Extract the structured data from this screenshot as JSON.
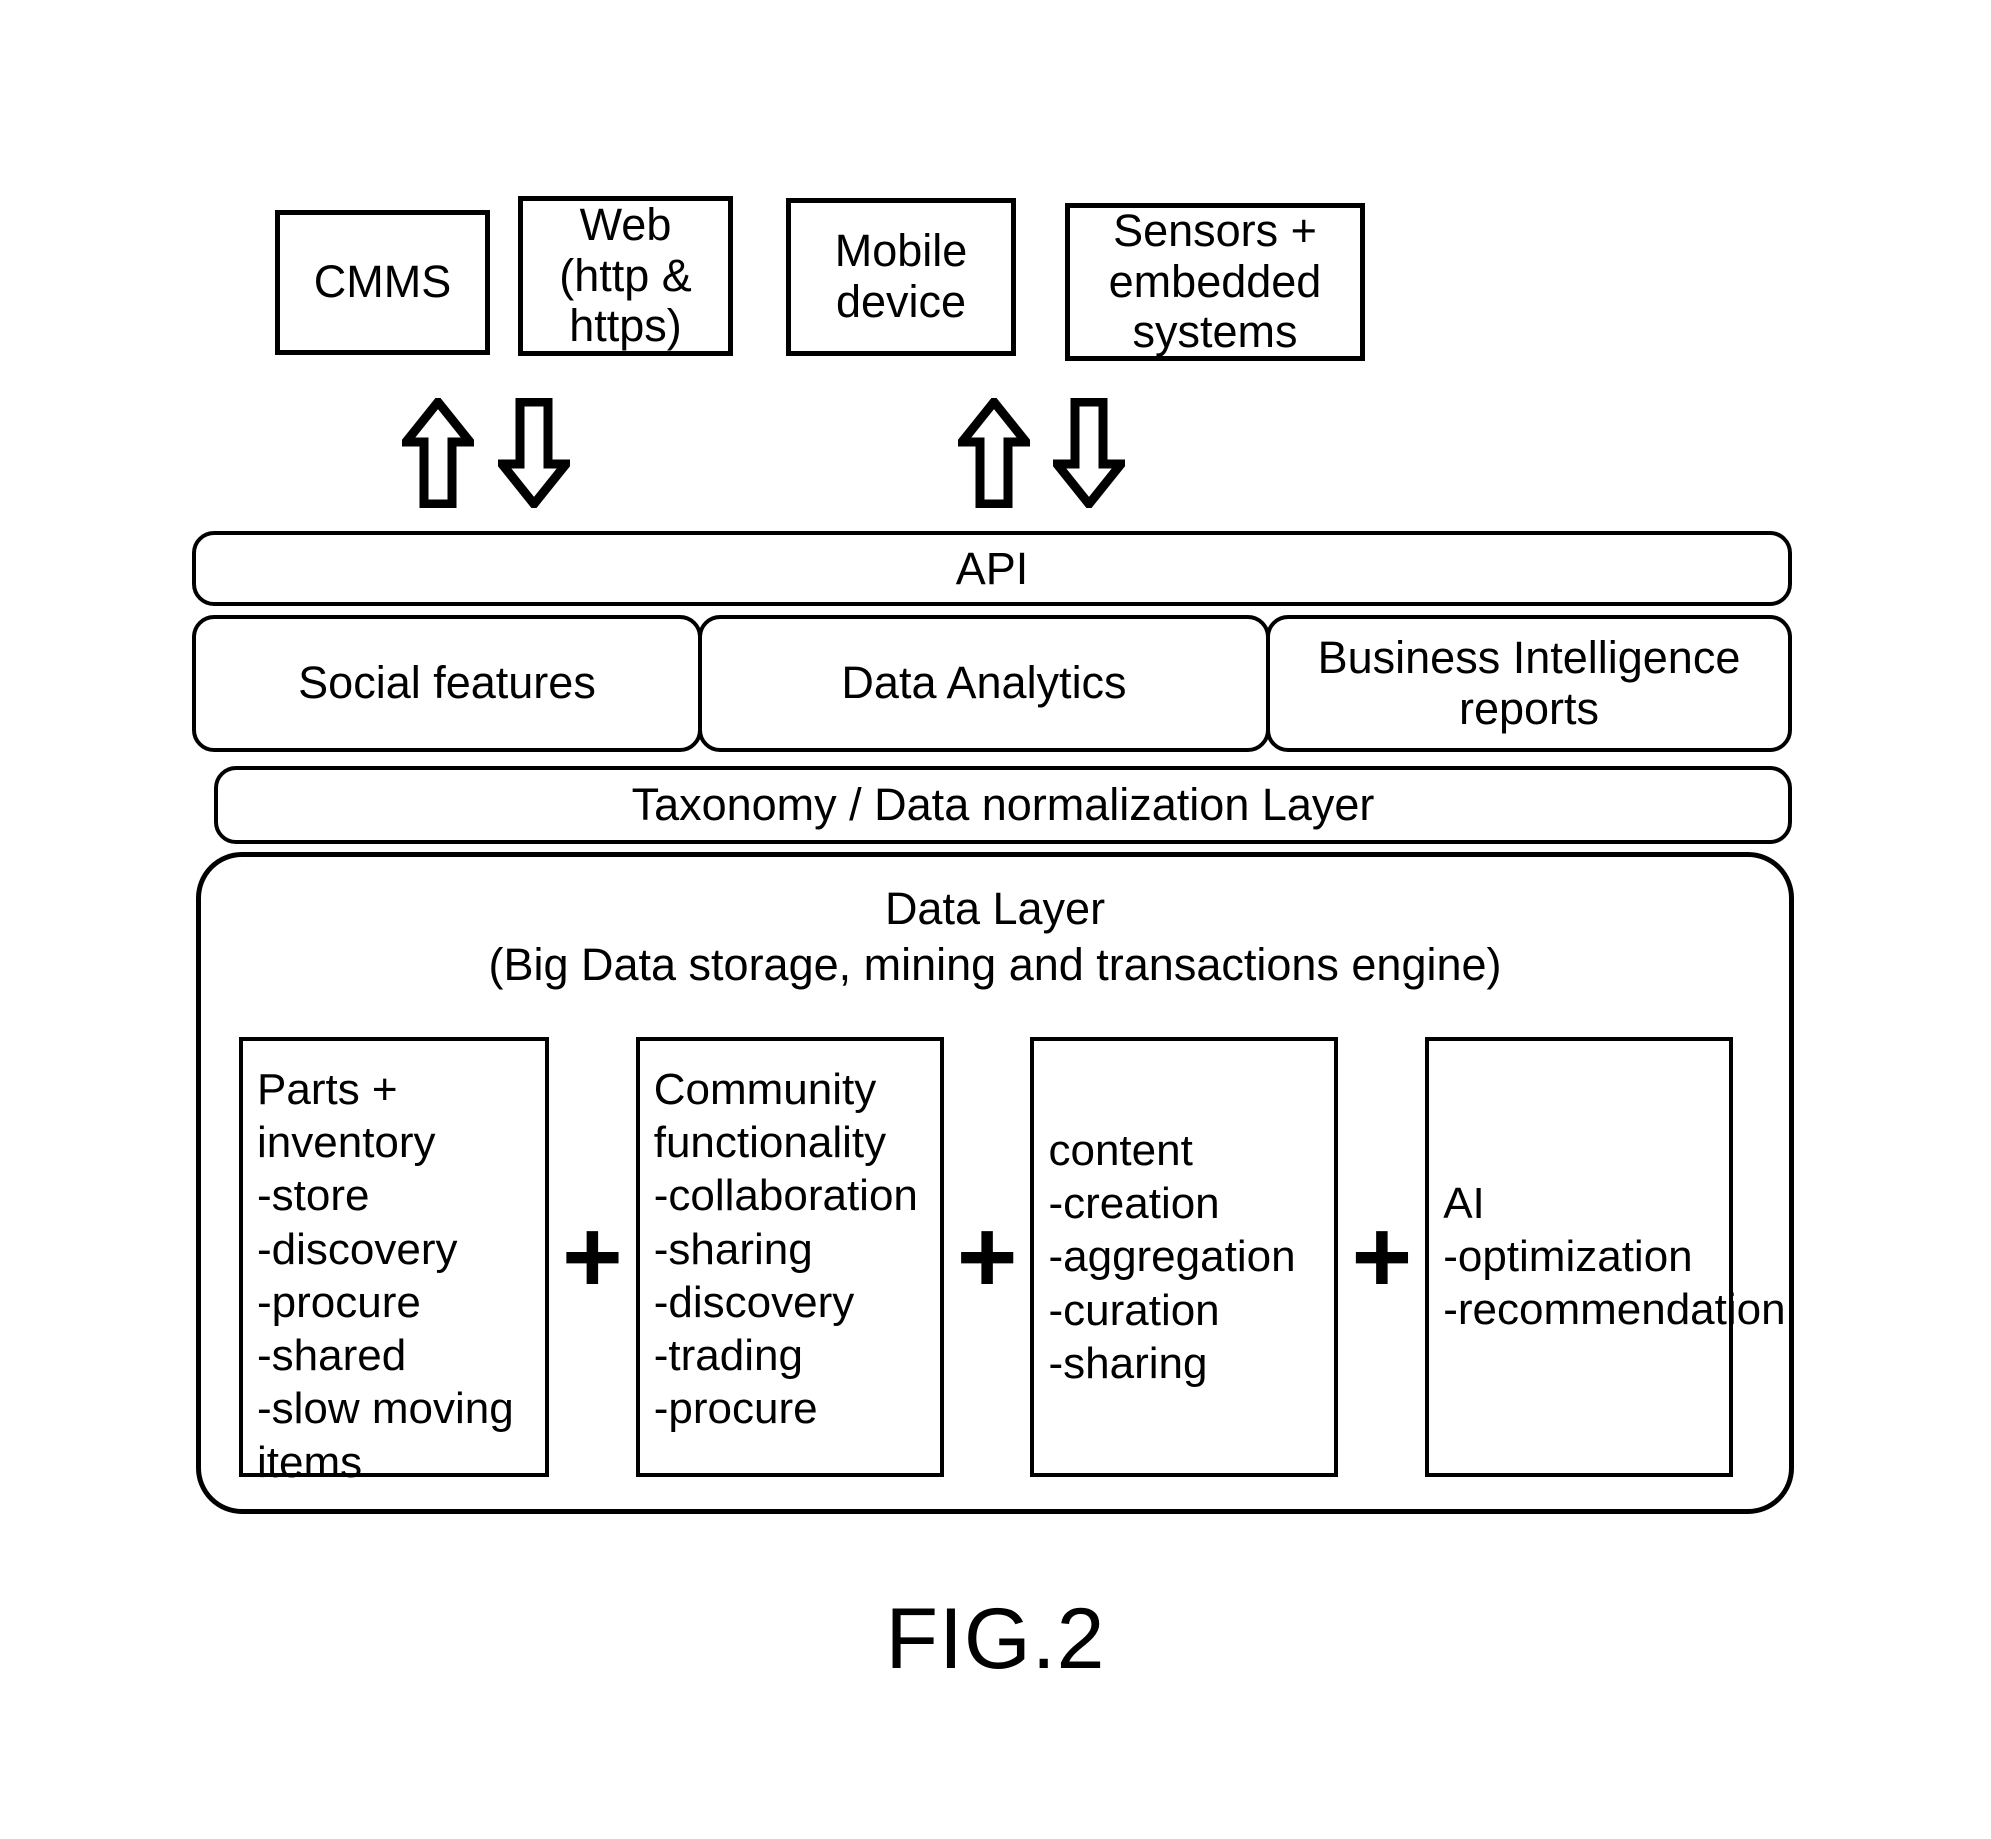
{
  "figure": {
    "caption": "FIG.2"
  },
  "endpoints": [
    {
      "id": "cmms",
      "label": "CMMS"
    },
    {
      "id": "web",
      "label": "Web\n(http &\nhttps)"
    },
    {
      "id": "mobile",
      "label": "Mobile\ndevice"
    },
    {
      "id": "sensor",
      "label": "Sensors +\nembedded\nsystems"
    }
  ],
  "arrows": [
    {
      "id": "cmms-up",
      "direction": "up",
      "icon": "arrow-up-icon"
    },
    {
      "id": "cmms-down",
      "direction": "down",
      "icon": "arrow-down-icon"
    },
    {
      "id": "mobile-up",
      "direction": "up",
      "icon": "arrow-up-icon"
    },
    {
      "id": "mobile-down",
      "direction": "down",
      "icon": "arrow-down-icon"
    }
  ],
  "api": {
    "label": "API"
  },
  "services": [
    {
      "id": "social",
      "label": "Social features"
    },
    {
      "id": "analytics",
      "label": "Data Analytics"
    },
    {
      "id": "bi",
      "label": "Business Intelligence\nreports"
    }
  ],
  "taxonomy": {
    "label": "Taxonomy / Data normalization Layer"
  },
  "data_layer": {
    "title_line1": "Data Layer",
    "title_line2": "(Big Data storage, mining and transactions engine)",
    "plus_symbol": "+",
    "components": [
      {
        "id": "parts",
        "align": "top",
        "lines": [
          "Parts +",
          "inventory",
          "-store",
          "-discovery",
          "-procure",
          "-shared",
          "-slow moving",
          "items"
        ]
      },
      {
        "id": "community",
        "align": "top",
        "lines": [
          "Community",
          "functionality",
          "-collaboration",
          "-sharing",
          "-discovery",
          "-trading",
          "-procure"
        ]
      },
      {
        "id": "content",
        "align": "mid",
        "lines": [
          "content",
          "-creation",
          "-aggregation",
          "-curation",
          "-sharing"
        ]
      },
      {
        "id": "ai",
        "align": "mid",
        "lines": [
          "AI",
          "-optimization",
          "-recommendation"
        ]
      }
    ]
  },
  "colors": {
    "stroke": "#000000",
    "background": "#ffffff",
    "text": "#000000"
  }
}
